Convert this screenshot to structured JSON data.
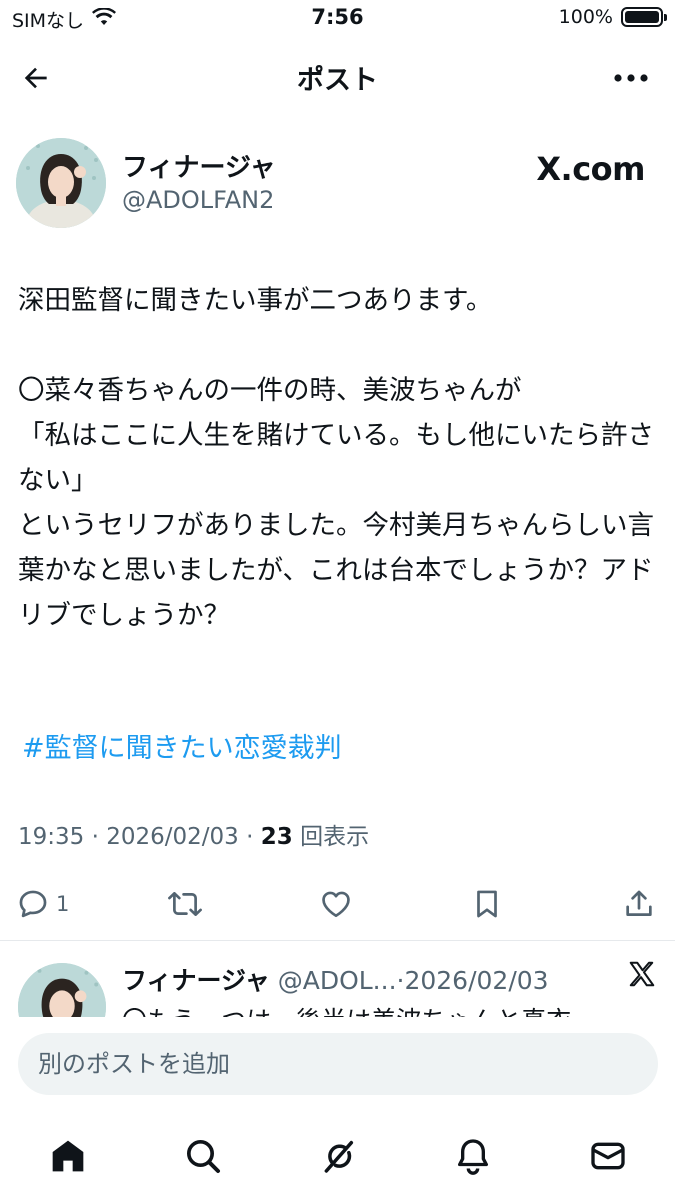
{
  "status_bar": {
    "carrier": "SIMなし",
    "time": "7:56",
    "battery": "100%",
    "battery_level": 1.0
  },
  "header": {
    "title": "ポスト"
  },
  "post": {
    "author_name": "フィナージャ",
    "author_handle": "@ADOLFAN2",
    "source_logo": "X.com",
    "body": "深田監督に聞きたい事が二つあります。\n\n〇菜々香ちゃんの一件の時、美波ちゃんが\n「私はここに人生を賭けている。もし他にいたら許さない」\nというセリフがありました。今村美月ちゃんらしい言葉かなと思いましたが、これは台本でしょうか？アドリブでしょうか？",
    "hashtag": "#監督に聞きたい恋愛裁判",
    "time": "19:35",
    "date": "2026/02/03",
    "views_count": "23",
    "views_label": "回表示",
    "reply_count": "1"
  },
  "reply_preview": {
    "author_name": "フィナージャ",
    "meta": "@ADOL...·2026/02/03",
    "text": "〇もう一つは、後半は美波ちゃんと真衣"
  },
  "compose": {
    "placeholder": "別のポストを追加"
  },
  "icons": {
    "back": "arrow-left-icon",
    "more": "more-horizontal-icon",
    "reply": "comment-icon",
    "repost": "repost-icon",
    "like": "heart-icon",
    "bookmark": "bookmark-icon",
    "share": "share-icon",
    "nav": [
      "home-icon",
      "search-icon",
      "grok-icon",
      "notifications-icon",
      "messages-icon"
    ]
  },
  "colors": {
    "text": "#0f1419",
    "secondary": "#536471",
    "link": "#1d9bf0",
    "input_bg": "#eff3f4"
  }
}
